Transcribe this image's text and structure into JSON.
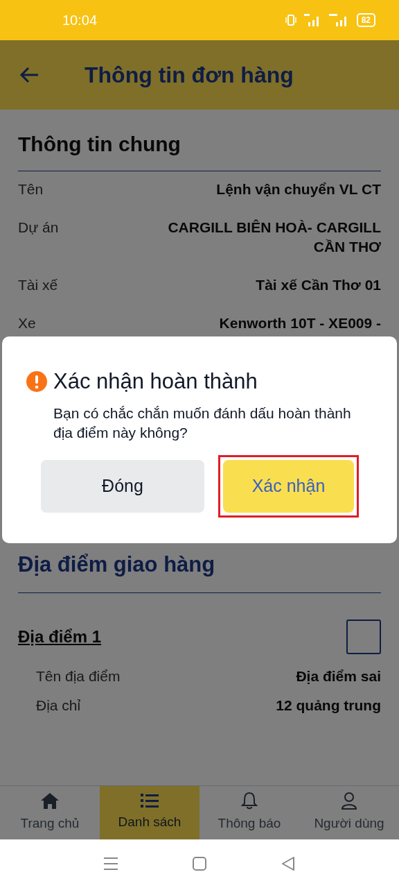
{
  "status_bar": {
    "time": "10:04",
    "battery": "82"
  },
  "app_bar": {
    "title": "Thông tin đơn hàng"
  },
  "general": {
    "heading": "Thông tin chung",
    "rows": [
      {
        "label": "Tên",
        "value": "Lệnh vận chuyển VL CT"
      },
      {
        "label": "Dự án",
        "value": "CARGILL BIÊN HOÀ- CARGILL CẦN THƠ"
      },
      {
        "label": "Tài xế",
        "value": "Tài xế Cần Thơ 01"
      },
      {
        "label": "Xe",
        "value": "Kenworth 10T - XE009 -"
      }
    ]
  },
  "delivery": {
    "heading": "Địa điểm giao hàng",
    "locations": [
      {
        "title": "Địa điểm 1",
        "checked": false,
        "rows": [
          {
            "label": "Tên địa điểm",
            "value": "Địa điểm sai"
          },
          {
            "label": "Địa chỉ",
            "value": "12 quảng trung"
          }
        ]
      }
    ]
  },
  "bottom_nav": [
    {
      "label": "Trang chủ",
      "selected": false
    },
    {
      "label": "Danh sách",
      "selected": true
    },
    {
      "label": "Thông báo",
      "selected": false
    },
    {
      "label": "Người dùng",
      "selected": false
    }
  ],
  "dialog": {
    "title": "Xác nhận hoàn thành",
    "message": "Bạn có chắc chắn muốn đánh dấu hoàn thành địa điểm này không?",
    "buttons": [
      {
        "label": "Đóng",
        "kind": "secondary",
        "highlighted": false
      },
      {
        "label": "Xác nhận",
        "kind": "primary",
        "highlighted": true
      }
    ]
  }
}
